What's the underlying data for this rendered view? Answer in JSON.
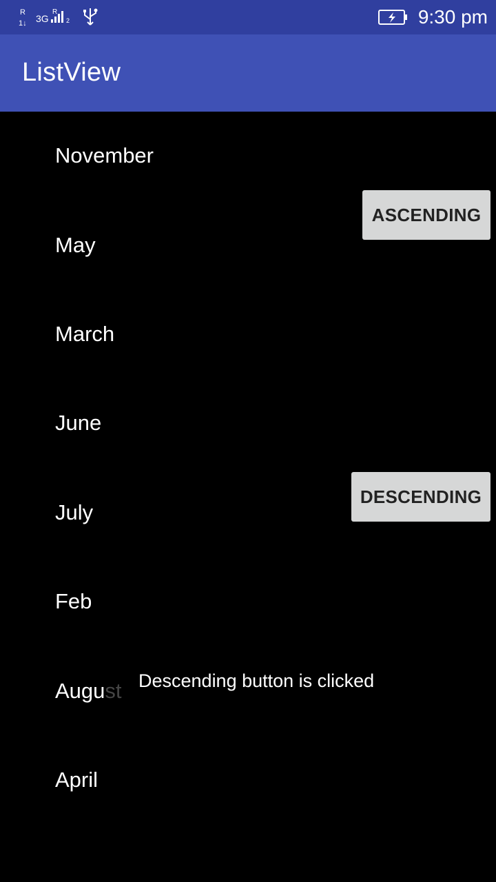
{
  "status_bar": {
    "network_label": "3G",
    "roaming_label": "R",
    "time": "9:30 pm",
    "icons": [
      "roaming-data-icon",
      "signal-3g-icon",
      "usb-icon",
      "battery-charging-icon"
    ]
  },
  "app_bar": {
    "title": "ListView",
    "background_color": "#3f51b5",
    "status_color": "#303f9f"
  },
  "months": [
    {
      "label": "November"
    },
    {
      "label": "May"
    },
    {
      "label": "March"
    },
    {
      "label": "June"
    },
    {
      "label": "July"
    },
    {
      "label": "Feb"
    },
    {
      "label_visible": "Augu",
      "label_faded": "st"
    },
    {
      "label": "April"
    }
  ],
  "buttons": {
    "ascending": "ASCENDING",
    "descending": "DESCENDING"
  },
  "toast": {
    "message": "Descending button is clicked"
  }
}
